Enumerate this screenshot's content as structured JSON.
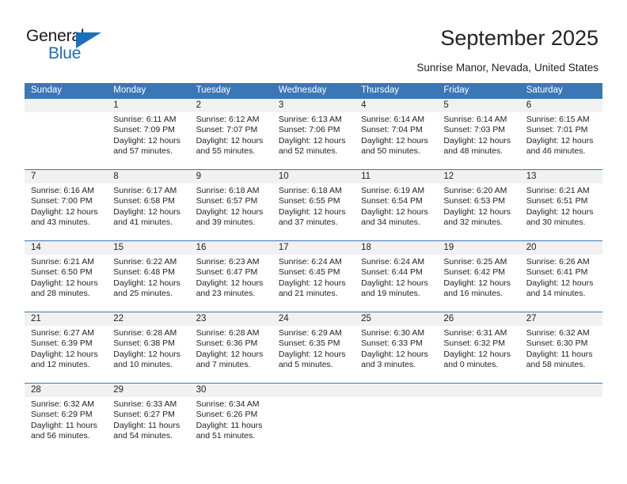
{
  "brand": {
    "name_part1": "General",
    "name_part2": "Blue",
    "accent_color": "#1c6fba"
  },
  "header": {
    "title": "September 2025",
    "subtitle": "Sunrise Manor, Nevada, United States"
  },
  "theme": {
    "header_blue": "#3b77b6",
    "daynum_band": "#f1f1f1",
    "text": "#222222"
  },
  "weekdays": [
    "Sunday",
    "Monday",
    "Tuesday",
    "Wednesday",
    "Thursday",
    "Friday",
    "Saturday"
  ],
  "weeks": [
    {
      "days": [
        {
          "num": "",
          "sunrise": "",
          "sunset": "",
          "daylight_a": "",
          "daylight_b": ""
        },
        {
          "num": "1",
          "sunrise": "Sunrise: 6:11 AM",
          "sunset": "Sunset: 7:09 PM",
          "daylight_a": "Daylight: 12 hours",
          "daylight_b": "and 57 minutes."
        },
        {
          "num": "2",
          "sunrise": "Sunrise: 6:12 AM",
          "sunset": "Sunset: 7:07 PM",
          "daylight_a": "Daylight: 12 hours",
          "daylight_b": "and 55 minutes."
        },
        {
          "num": "3",
          "sunrise": "Sunrise: 6:13 AM",
          "sunset": "Sunset: 7:06 PM",
          "daylight_a": "Daylight: 12 hours",
          "daylight_b": "and 52 minutes."
        },
        {
          "num": "4",
          "sunrise": "Sunrise: 6:14 AM",
          "sunset": "Sunset: 7:04 PM",
          "daylight_a": "Daylight: 12 hours",
          "daylight_b": "and 50 minutes."
        },
        {
          "num": "5",
          "sunrise": "Sunrise: 6:14 AM",
          "sunset": "Sunset: 7:03 PM",
          "daylight_a": "Daylight: 12 hours",
          "daylight_b": "and 48 minutes."
        },
        {
          "num": "6",
          "sunrise": "Sunrise: 6:15 AM",
          "sunset": "Sunset: 7:01 PM",
          "daylight_a": "Daylight: 12 hours",
          "daylight_b": "and 46 minutes."
        }
      ]
    },
    {
      "days": [
        {
          "num": "7",
          "sunrise": "Sunrise: 6:16 AM",
          "sunset": "Sunset: 7:00 PM",
          "daylight_a": "Daylight: 12 hours",
          "daylight_b": "and 43 minutes."
        },
        {
          "num": "8",
          "sunrise": "Sunrise: 6:17 AM",
          "sunset": "Sunset: 6:58 PM",
          "daylight_a": "Daylight: 12 hours",
          "daylight_b": "and 41 minutes."
        },
        {
          "num": "9",
          "sunrise": "Sunrise: 6:18 AM",
          "sunset": "Sunset: 6:57 PM",
          "daylight_a": "Daylight: 12 hours",
          "daylight_b": "and 39 minutes."
        },
        {
          "num": "10",
          "sunrise": "Sunrise: 6:18 AM",
          "sunset": "Sunset: 6:55 PM",
          "daylight_a": "Daylight: 12 hours",
          "daylight_b": "and 37 minutes."
        },
        {
          "num": "11",
          "sunrise": "Sunrise: 6:19 AM",
          "sunset": "Sunset: 6:54 PM",
          "daylight_a": "Daylight: 12 hours",
          "daylight_b": "and 34 minutes."
        },
        {
          "num": "12",
          "sunrise": "Sunrise: 6:20 AM",
          "sunset": "Sunset: 6:53 PM",
          "daylight_a": "Daylight: 12 hours",
          "daylight_b": "and 32 minutes."
        },
        {
          "num": "13",
          "sunrise": "Sunrise: 6:21 AM",
          "sunset": "Sunset: 6:51 PM",
          "daylight_a": "Daylight: 12 hours",
          "daylight_b": "and 30 minutes."
        }
      ]
    },
    {
      "days": [
        {
          "num": "14",
          "sunrise": "Sunrise: 6:21 AM",
          "sunset": "Sunset: 6:50 PM",
          "daylight_a": "Daylight: 12 hours",
          "daylight_b": "and 28 minutes."
        },
        {
          "num": "15",
          "sunrise": "Sunrise: 6:22 AM",
          "sunset": "Sunset: 6:48 PM",
          "daylight_a": "Daylight: 12 hours",
          "daylight_b": "and 25 minutes."
        },
        {
          "num": "16",
          "sunrise": "Sunrise: 6:23 AM",
          "sunset": "Sunset: 6:47 PM",
          "daylight_a": "Daylight: 12 hours",
          "daylight_b": "and 23 minutes."
        },
        {
          "num": "17",
          "sunrise": "Sunrise: 6:24 AM",
          "sunset": "Sunset: 6:45 PM",
          "daylight_a": "Daylight: 12 hours",
          "daylight_b": "and 21 minutes."
        },
        {
          "num": "18",
          "sunrise": "Sunrise: 6:24 AM",
          "sunset": "Sunset: 6:44 PM",
          "daylight_a": "Daylight: 12 hours",
          "daylight_b": "and 19 minutes."
        },
        {
          "num": "19",
          "sunrise": "Sunrise: 6:25 AM",
          "sunset": "Sunset: 6:42 PM",
          "daylight_a": "Daylight: 12 hours",
          "daylight_b": "and 16 minutes."
        },
        {
          "num": "20",
          "sunrise": "Sunrise: 6:26 AM",
          "sunset": "Sunset: 6:41 PM",
          "daylight_a": "Daylight: 12 hours",
          "daylight_b": "and 14 minutes."
        }
      ]
    },
    {
      "days": [
        {
          "num": "21",
          "sunrise": "Sunrise: 6:27 AM",
          "sunset": "Sunset: 6:39 PM",
          "daylight_a": "Daylight: 12 hours",
          "daylight_b": "and 12 minutes."
        },
        {
          "num": "22",
          "sunrise": "Sunrise: 6:28 AM",
          "sunset": "Sunset: 6:38 PM",
          "daylight_a": "Daylight: 12 hours",
          "daylight_b": "and 10 minutes."
        },
        {
          "num": "23",
          "sunrise": "Sunrise: 6:28 AM",
          "sunset": "Sunset: 6:36 PM",
          "daylight_a": "Daylight: 12 hours",
          "daylight_b": "and 7 minutes."
        },
        {
          "num": "24",
          "sunrise": "Sunrise: 6:29 AM",
          "sunset": "Sunset: 6:35 PM",
          "daylight_a": "Daylight: 12 hours",
          "daylight_b": "and 5 minutes."
        },
        {
          "num": "25",
          "sunrise": "Sunrise: 6:30 AM",
          "sunset": "Sunset: 6:33 PM",
          "daylight_a": "Daylight: 12 hours",
          "daylight_b": "and 3 minutes."
        },
        {
          "num": "26",
          "sunrise": "Sunrise: 6:31 AM",
          "sunset": "Sunset: 6:32 PM",
          "daylight_a": "Daylight: 12 hours",
          "daylight_b": "and 0 minutes."
        },
        {
          "num": "27",
          "sunrise": "Sunrise: 6:32 AM",
          "sunset": "Sunset: 6:30 PM",
          "daylight_a": "Daylight: 11 hours",
          "daylight_b": "and 58 minutes."
        }
      ]
    },
    {
      "days": [
        {
          "num": "28",
          "sunrise": "Sunrise: 6:32 AM",
          "sunset": "Sunset: 6:29 PM",
          "daylight_a": "Daylight: 11 hours",
          "daylight_b": "and 56 minutes."
        },
        {
          "num": "29",
          "sunrise": "Sunrise: 6:33 AM",
          "sunset": "Sunset: 6:27 PM",
          "daylight_a": "Daylight: 11 hours",
          "daylight_b": "and 54 minutes."
        },
        {
          "num": "30",
          "sunrise": "Sunrise: 6:34 AM",
          "sunset": "Sunset: 6:26 PM",
          "daylight_a": "Daylight: 11 hours",
          "daylight_b": "and 51 minutes."
        },
        {
          "num": "",
          "sunrise": "",
          "sunset": "",
          "daylight_a": "",
          "daylight_b": ""
        },
        {
          "num": "",
          "sunrise": "",
          "sunset": "",
          "daylight_a": "",
          "daylight_b": ""
        },
        {
          "num": "",
          "sunrise": "",
          "sunset": "",
          "daylight_a": "",
          "daylight_b": ""
        },
        {
          "num": "",
          "sunrise": "",
          "sunset": "",
          "daylight_a": "",
          "daylight_b": ""
        }
      ]
    }
  ]
}
